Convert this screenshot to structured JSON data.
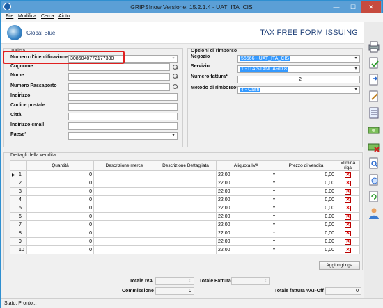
{
  "window": {
    "title": "GRIPS!now Versione: 15.2.1.4 - UAT_ITA_CIS",
    "min": "—",
    "max": "☐",
    "close": "✕"
  },
  "menu": {
    "items": [
      "File",
      "Modifica",
      "Cerca",
      "Aiuto"
    ]
  },
  "header": {
    "logo_text": "Global Blue",
    "form_title": "TAX FREE FORM ISSUING"
  },
  "turista": {
    "group_label": "Turista",
    "fields": [
      {
        "label": "Numero d'identificazione",
        "value": "3086040772177330"
      },
      {
        "label": "Cognome",
        "value": ""
      },
      {
        "label": "Nome",
        "value": ""
      },
      {
        "label": "Numero Passaporto",
        "value": ""
      },
      {
        "label": "Indirizzo",
        "value": ""
      },
      {
        "label": "Codice postale",
        "value": ""
      },
      {
        "label": "Città",
        "value": ""
      },
      {
        "label": "Indirizzo email",
        "value": ""
      },
      {
        "label": "Paese*",
        "value": ""
      }
    ]
  },
  "rimborso": {
    "group_label": "Opzioni di rimborso",
    "negozio_label": "Negozio",
    "negozio_value": "56666 - UAT_ITA_CIS",
    "servizio_label": "Servizio",
    "servizio_value": "1 - ITA STANDARD 8",
    "fattura_label": "Numero fattura*",
    "fattura_value": "2",
    "metodo_label": "Metodo di rimborso*",
    "metodo_value": "4 - Cash"
  },
  "vendita": {
    "group_label": "Dettagli della vendita",
    "columns": [
      "Quantità",
      "Descrizione merce",
      "Descrizione Dettagliata",
      "Aliquota IVA",
      "Prezzo di vendita",
      "Elimina riga"
    ],
    "rows": [
      {
        "n": "1",
        "qty": "0",
        "iva": "22,00",
        "price": "0,00"
      },
      {
        "n": "2",
        "qty": "0",
        "iva": "22,00",
        "price": "0,00"
      },
      {
        "n": "3",
        "qty": "0",
        "iva": "22,00",
        "price": "0,00"
      },
      {
        "n": "4",
        "qty": "0",
        "iva": "22,00",
        "price": "0,00"
      },
      {
        "n": "5",
        "qty": "0",
        "iva": "22,00",
        "price": "0,00"
      },
      {
        "n": "6",
        "qty": "0",
        "iva": "22,00",
        "price": "0,00"
      },
      {
        "n": "7",
        "qty": "0",
        "iva": "22,00",
        "price": "0,00"
      },
      {
        "n": "8",
        "qty": "0",
        "iva": "22,00",
        "price": "0,00"
      },
      {
        "n": "9",
        "qty": "0",
        "iva": "22,00",
        "price": "0,00"
      },
      {
        "n": "10",
        "qty": "0",
        "iva": "22,00",
        "price": "0,00"
      }
    ],
    "add_row": "Aggiungi riga"
  },
  "totals": {
    "iva_label": "Totale IVA",
    "iva_value": "0",
    "fattura_label": "Totale Fattura",
    "fattura_value": "0",
    "commissione_label": "Commissione",
    "commissione_value": "0",
    "vatoff_label": "Totale fattura VAT-Off",
    "vatoff_value": "0"
  },
  "status": {
    "text": "Stato: Pronto..."
  },
  "colors": {
    "titlebar": "#5b9fd6",
    "highlight": "#e02020",
    "selection": "#3399ff",
    "brand": "#1e3f77"
  }
}
